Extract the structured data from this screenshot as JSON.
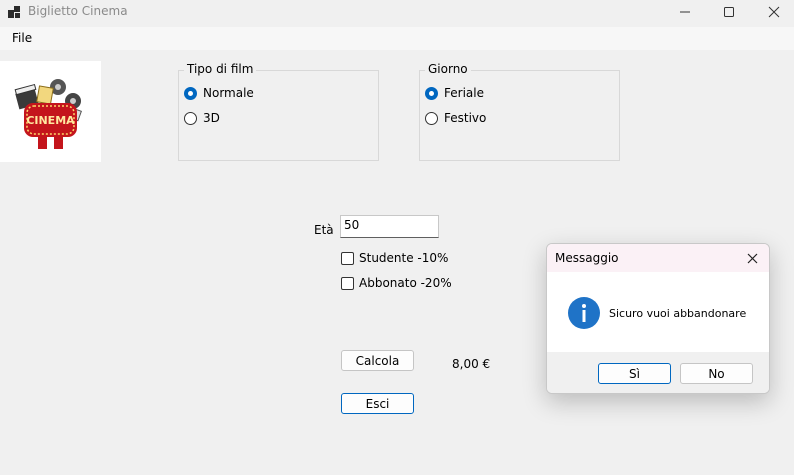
{
  "window": {
    "title": "Biglietto Cinema"
  },
  "menu": {
    "file": "File"
  },
  "logo": {
    "text": "CINEMA"
  },
  "tipo_film": {
    "legend": "Tipo di film",
    "options": [
      "Normale",
      "3D"
    ],
    "selected": "Normale"
  },
  "giorno": {
    "legend": "Giorno",
    "options": [
      "Feriale",
      "Festivo"
    ],
    "selected": "Feriale"
  },
  "eta": {
    "label": "Età",
    "value": "50"
  },
  "sconti": {
    "studente": "Studente -10%",
    "abbonato": "Abbonato -20%"
  },
  "buttons": {
    "calcola": "Calcola",
    "esci": "Esci"
  },
  "result": {
    "price": "8,00 €"
  },
  "dialog": {
    "title": "Messaggio",
    "message": "Sicuro vuoi abbandonare",
    "yes": "Sì",
    "no": "No"
  },
  "colors": {
    "accent": "#0067c0",
    "dialog_header": "#fbf1f6"
  }
}
